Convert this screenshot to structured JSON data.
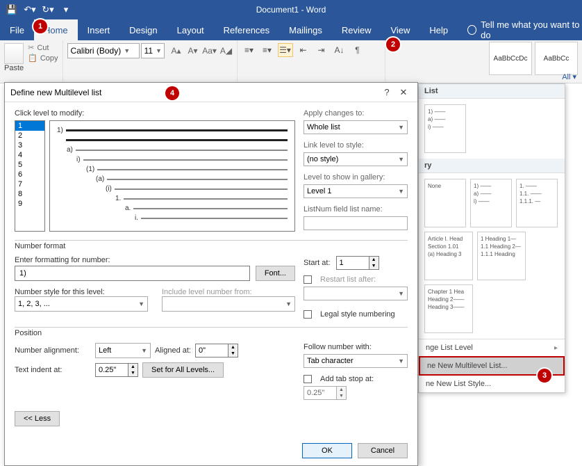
{
  "titlebar": {
    "doc": "Document1 - Word"
  },
  "menu": {
    "file": "File",
    "home": "Home",
    "insert": "Insert",
    "design": "Design",
    "layout": "Layout",
    "references": "References",
    "mailings": "Mailings",
    "review": "Review",
    "view": "View",
    "help": "Help",
    "tellme": "Tell me what you want to do"
  },
  "ribbon": {
    "paste": "Paste",
    "cut": "Cut",
    "copy": "Copy",
    "font_name": "Calibri (Body)",
    "font_size": "11",
    "style1": "AaBbCcDc",
    "style2": "AaBbCc",
    "all": "All"
  },
  "dropdown": {
    "head1": "List",
    "head2": "ry",
    "item_none": "None",
    "item1_l1": "1)",
    "item1_l2": "a)",
    "item1_l3": "i)",
    "item2_l1": "1.",
    "item2_l2": "1.1.",
    "item2_l3": "1.1.1.",
    "item3_l1": "Article I.",
    "item3_l2": "Section 1.01",
    "item3_l3": "(a) Heading 3",
    "item3b_l1": "1 Heading 1",
    "item3b_l2": "1.1 Heading 2",
    "item3b_l3": "1.1.1 Heading",
    "item4_l1": "Chapter 1",
    "item4_l2": "Heading 2",
    "item4_l3": "Heading 3",
    "menu1": "nge List Level",
    "menu2": "ne New Multilevel List...",
    "menu3": "ne New List Style..."
  },
  "dialog": {
    "title": "Define new Multilevel list",
    "click_level": "Click level to modify:",
    "levels": [
      "1",
      "2",
      "3",
      "4",
      "5",
      "6",
      "7",
      "8",
      "9"
    ],
    "preview": [
      "1)",
      "a)",
      "i)",
      "(1)",
      "(a)",
      "(i)",
      "1.",
      "a.",
      "i."
    ],
    "apply_to": "Apply changes to:",
    "apply_val": "Whole list",
    "link_style": "Link level to style:",
    "link_val": "(no style)",
    "show_gallery": "Level to show in gallery:",
    "show_val": "Level 1",
    "listnum": "ListNum field list name:",
    "numformat": "Number format",
    "enter_fmt": "Enter formatting for number:",
    "fmt_val": "1)",
    "font_btn": "Font...",
    "numstyle": "Number style for this level:",
    "numstyle_val": "1, 2, 3, ...",
    "include": "Include level number from:",
    "start_at": "Start at:",
    "start_val": "1",
    "restart": "Restart list after:",
    "legal": "Legal style numbering",
    "position": "Position",
    "align_lbl": "Number alignment:",
    "align_val": "Left",
    "aligned_at": "Aligned at:",
    "aligned_val": "0\"",
    "indent_lbl": "Text indent at:",
    "indent_val": "0.25\"",
    "setall": "Set for All Levels...",
    "follow": "Follow number with:",
    "follow_val": "Tab character",
    "addtab": "Add tab stop at:",
    "addtab_val": "0.25\"",
    "less": "<<  Less",
    "ok": "OK",
    "cancel": "Cancel"
  },
  "callouts": {
    "c1": "1",
    "c2": "2",
    "c3": "3",
    "c4": "4"
  }
}
